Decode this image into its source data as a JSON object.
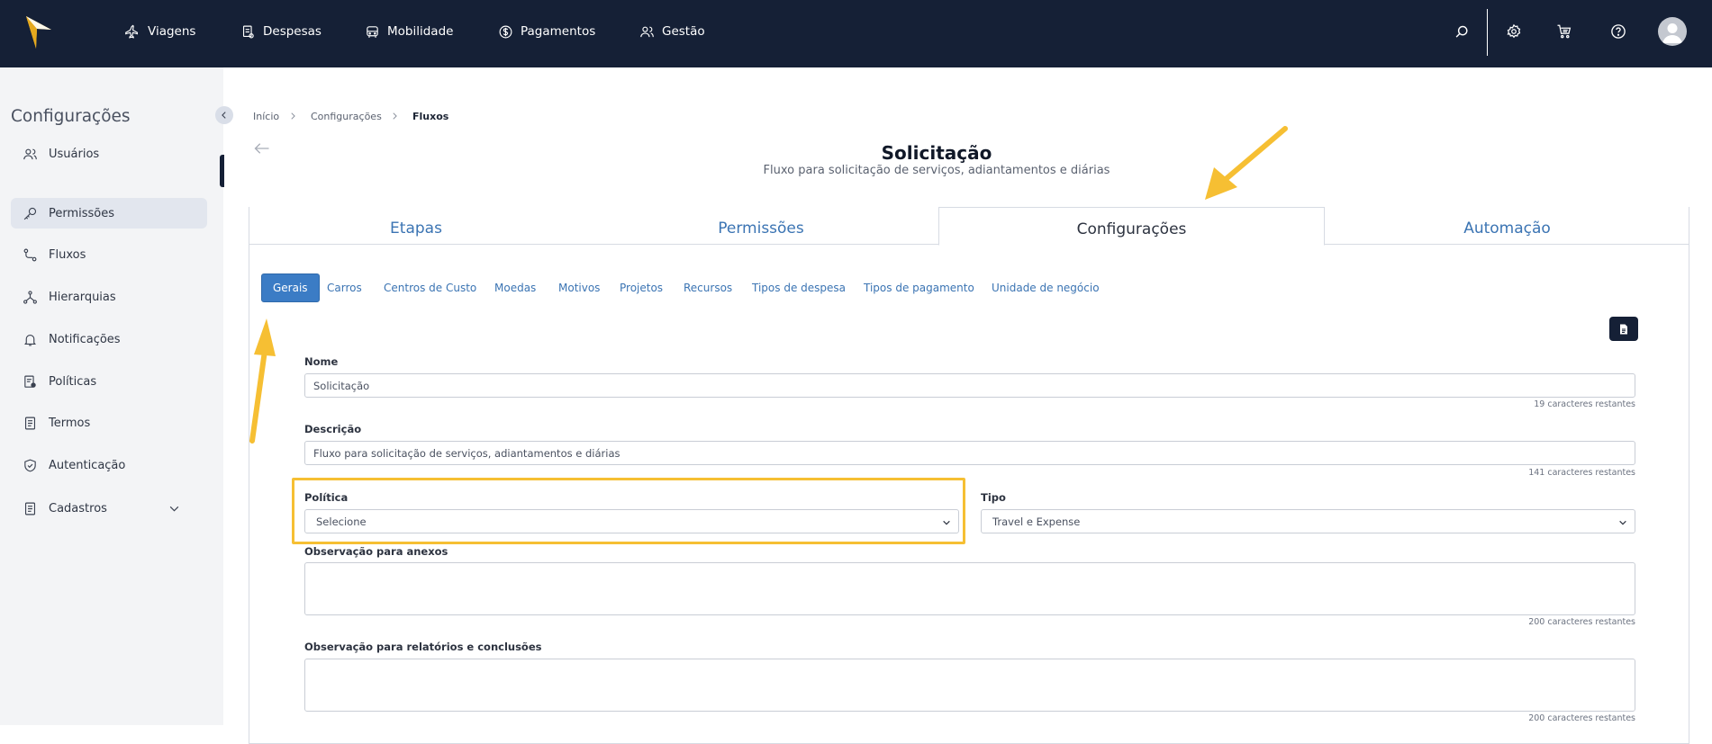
{
  "nav": {
    "items": [
      {
        "label": "Viagens",
        "icon": "airplane-icon"
      },
      {
        "label": "Despesas",
        "icon": "receipt-icon"
      },
      {
        "label": "Mobilidade",
        "icon": "car-icon"
      },
      {
        "label": "Pagamentos",
        "icon": "dollar-icon"
      },
      {
        "label": "Gestão",
        "icon": "users-icon"
      }
    ],
    "right_icons": [
      "search-icon",
      "gear-icon",
      "cart-icon",
      "help-icon",
      "user-avatar"
    ]
  },
  "sidebar": {
    "title": "Configurações",
    "items": [
      {
        "label": "Usuários",
        "icon": "users-icon"
      },
      {
        "label": "Permissões",
        "icon": "key-icon"
      },
      {
        "label": "Fluxos",
        "icon": "flow-icon"
      },
      {
        "label": "Hierarquias",
        "icon": "hierarchy-icon"
      },
      {
        "label": "Notificações",
        "icon": "bell-icon"
      },
      {
        "label": "Políticas",
        "icon": "policy-icon"
      },
      {
        "label": "Termos",
        "icon": "document-icon"
      },
      {
        "label": "Autenticação",
        "icon": "shield-icon"
      },
      {
        "label": "Cadastros",
        "icon": "register-icon"
      }
    ],
    "active": "Permissões"
  },
  "breadcrumb": [
    "Início",
    "Configurações",
    "Fluxos"
  ],
  "page": {
    "title": "Solicitação",
    "subtitle": "Fluxo para solicitação de serviços, adiantamentos e diárias"
  },
  "tabs": [
    "Etapas",
    "Permissões",
    "Configurações",
    "Automação"
  ],
  "active_tab": "Configurações",
  "subtabs": [
    "Gerais",
    "Carros",
    "Centros de Custo",
    "Moedas",
    "Motivos",
    "Projetos",
    "Recursos",
    "Tipos de despesa",
    "Tipos de pagamento",
    "Unidade de negócio"
  ],
  "active_subtab": "Gerais",
  "form": {
    "nome": {
      "label": "Nome",
      "value": "Solicitação",
      "counter": "19 caracteres restantes"
    },
    "descricao": {
      "label": "Descrição",
      "value": "Fluxo para solicitação de serviços, adiantamentos e diárias",
      "counter": "141 caracteres restantes"
    },
    "politica": {
      "label": "Política",
      "value": "Selecione"
    },
    "tipo": {
      "label": "Tipo",
      "value": "Travel e Expense"
    },
    "obs_anexos": {
      "label": "Observação para anexos",
      "value": "",
      "counter": "200 caracteres restantes"
    },
    "obs_relatorios": {
      "label": "Observação para relatórios e conclusões",
      "value": "",
      "counter": "200 caracteres restantes"
    }
  },
  "colors": {
    "topbar": "#152036",
    "accent": "#3b74b3",
    "highlight": "#f6bf33",
    "logo": "#f6bf33"
  }
}
